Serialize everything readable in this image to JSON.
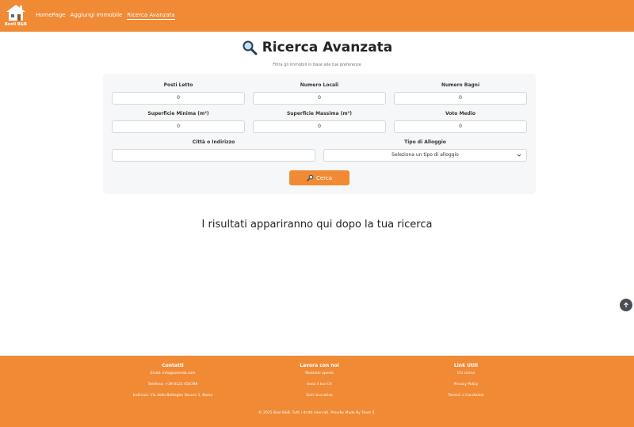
{
  "nav": {
    "logo_text": "Booll B&B",
    "links": [
      "HomePage",
      "Aggiungi Immobile",
      "Ricerca Avanzata"
    ]
  },
  "header": {
    "title": "Ricerca Avanzata",
    "subtitle": "Filtra gli immobili in base alle tue preferenze"
  },
  "form": {
    "posti_letto": {
      "label": "Posti Letto",
      "value": "0"
    },
    "numero_locali": {
      "label": "Numero Locali",
      "value": "0"
    },
    "numero_bagni": {
      "label": "Numero Bagni",
      "value": "0"
    },
    "superficie_minima": {
      "label": "Superficie Minima (m²)",
      "value": "0"
    },
    "superficie_massima": {
      "label": "Superficie Massima (m²)",
      "value": "0"
    },
    "voto_medio": {
      "label": "Voto Medio",
      "value": "0"
    },
    "citta": {
      "label": "Città o Indirizzo",
      "value": ""
    },
    "tipo": {
      "label": "Tipo di Alloggio",
      "selected": "Seleziona un tipo di alloggio"
    },
    "search_button": "Cerca"
  },
  "results_placeholder": "I risultati appariranno qui dopo la tua ricerca",
  "footer": {
    "contatti": {
      "heading": "Contatti",
      "items": [
        "Email: info@azienda.com",
        "Telefono: +39 0123 456789",
        "Indirizzo: Via delle Botteghe Oscure 1, Roma"
      ]
    },
    "lavora": {
      "heading": "Lavora con noi",
      "items": [
        "Posizioni aperte",
        "Invia il tuo CV",
        "Sedi lavorative"
      ]
    },
    "link": {
      "heading": "Link Utili",
      "items": [
        "Chi siamo",
        "Privacy Policy",
        "Termini e Condizioni"
      ]
    },
    "copyright": "© 2025 Bool B&B. Tutti i diritti riservati. Proudly Made By Team 5."
  },
  "colors": {
    "accent": "#f08a35",
    "card_bg": "#f6f7f8"
  },
  "icons": [
    "house-logo-icon",
    "magnifier-icon",
    "chevron-down-icon",
    "arrow-up-icon"
  ]
}
